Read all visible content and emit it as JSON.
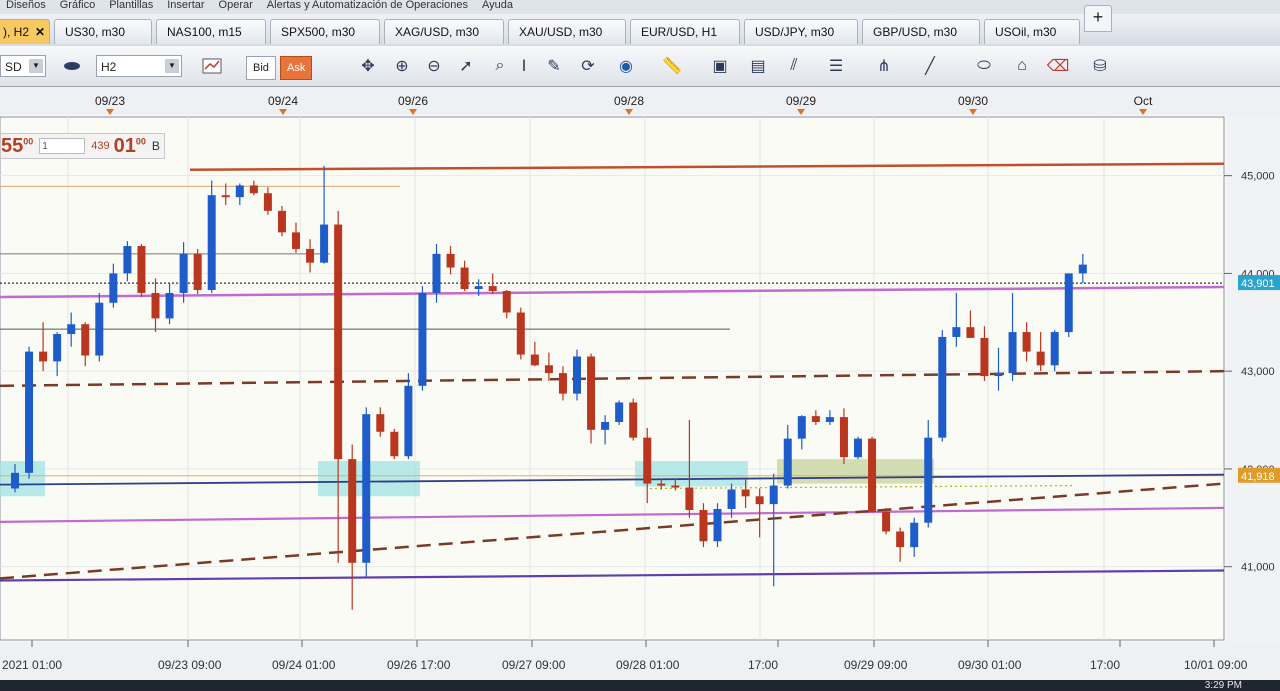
{
  "menu": [
    "Diseños",
    "Gráfico",
    "Plantillas",
    "Insertar",
    "Operar",
    "Alertas y Automatización de Operaciones",
    "Ayuda"
  ],
  "tabs": [
    {
      "label": "), H2",
      "active": true,
      "closable": true
    },
    {
      "label": "US30, m30"
    },
    {
      "label": "NAS100, m15"
    },
    {
      "label": "SPX500, m30"
    },
    {
      "label": "XAG/USD, m30"
    },
    {
      "label": "XAU/USD, m30"
    },
    {
      "label": "EUR/USD, H1"
    },
    {
      "label": "USD/JPY, m30"
    },
    {
      "label": "GBP/USD, m30"
    },
    {
      "label": "USOil, m30"
    }
  ],
  "new_tab_label": "+",
  "toolbar": {
    "symbol": "SD",
    "timeframe": "H2",
    "bid_label": "Bid",
    "ask_label": "Ask",
    "icons": [
      "chart-type-icon",
      "crosshair-icon",
      "zoom-in-icon",
      "zoom-out-icon",
      "cursor-icon",
      "magnifier-icon",
      "text-icon",
      "annotation-icon",
      "sync-icon",
      "globe-icon",
      "ruler-icon",
      "snapshot-icon",
      "template-icon",
      "fibonacci-icon",
      "lines-icon",
      "pitchfork-icon",
      "pen-icon",
      "shape-icon",
      "label-icon",
      "eraser-icon",
      "layers-icon"
    ]
  },
  "quote": {
    "price_main": "55",
    "price_sup": "00",
    "lots": "1",
    "spread": "439",
    "price2_main": "01",
    "price2_sup": "00",
    "side": "B"
  },
  "colors": {
    "bull": "#1e5cc9",
    "bear": "#b9361f",
    "red_line": "#c0502c",
    "magenta_line": "#c36ad0",
    "navy_line": "#2d3f8c",
    "purple_line": "#5f3fb0",
    "dashed_trend": "#7a3a28",
    "cyan_zone": "#9fe3e3",
    "olive_zone": "#c9d6a0",
    "price_label": "#29a3cf",
    "price_label2": "#e09b2b"
  },
  "chart_data": {
    "type": "candlestick",
    "top_date_labels": [
      "09/23",
      "09/24",
      "09/26",
      "09/28",
      "09/29",
      "09/30",
      "Oct"
    ],
    "bottom_time_labels": [
      "2021 01:00",
      "09/23 09:00",
      "09/24 01:00",
      "09/26 17:00",
      "09/27 09:00",
      "09/28 01:00",
      "17:00",
      "09/29 09:00",
      "09/30 01:00",
      "17:00",
      "10/01 09:00"
    ],
    "y_tick_labels": [
      "45,000",
      "44,000",
      "43,000",
      "42,000",
      "41,000"
    ],
    "price_labels": [
      {
        "text": "43,901",
        "kind": "current"
      },
      {
        "text": "41,918",
        "kind": "level"
      }
    ],
    "y_ticks": [
      45000,
      44000,
      43000,
      42000,
      41000
    ],
    "ylim": [
      40250,
      45600
    ],
    "levels": [
      {
        "name": "resistance-red",
        "value": 45060
      },
      {
        "name": "magenta-upper",
        "value": 43820
      },
      {
        "name": "magenta-lower",
        "value": 41540
      },
      {
        "name": "navy-support",
        "value": 41880
      },
      {
        "name": "purple-support",
        "value": 40920
      },
      {
        "name": "current-price",
        "value": 43901
      },
      {
        "name": "gold-level",
        "value": 41930
      }
    ],
    "candles": [
      [
        41800,
        42050,
        41760,
        41960
      ],
      [
        41960,
        43250,
        41900,
        43200
      ],
      [
        43200,
        43500,
        43000,
        43100
      ],
      [
        43100,
        43400,
        42950,
        43380
      ],
      [
        43380,
        43600,
        43250,
        43480
      ],
      [
        43480,
        43500,
        43050,
        43160
      ],
      [
        43160,
        43800,
        43100,
        43700
      ],
      [
        43700,
        44100,
        43650,
        44000
      ],
      [
        44000,
        44330,
        43920,
        44280
      ],
      [
        44280,
        44300,
        43760,
        43800
      ],
      [
        43800,
        43950,
        43400,
        43540
      ],
      [
        43540,
        43900,
        43480,
        43800
      ],
      [
        43800,
        44320,
        43700,
        44200
      ],
      [
        44200,
        44250,
        43790,
        43830
      ],
      [
        43830,
        44950,
        43800,
        44800
      ],
      [
        44800,
        44920,
        44700,
        44780
      ],
      [
        44780,
        44920,
        44700,
        44900
      ],
      [
        44900,
        44950,
        44800,
        44820
      ],
      [
        44820,
        44880,
        44600,
        44640
      ],
      [
        44640,
        44690,
        44380,
        44420
      ],
      [
        44420,
        44520,
        44210,
        44250
      ],
      [
        44250,
        44350,
        44010,
        44110
      ],
      [
        44110,
        45100,
        44100,
        44500
      ],
      [
        44500,
        44640,
        41040,
        42100
      ],
      [
        42100,
        42250,
        40560,
        41040
      ],
      [
        41040,
        42630,
        40900,
        42560
      ],
      [
        42560,
        42630,
        42330,
        42380
      ],
      [
        42380,
        42410,
        42100,
        42130
      ],
      [
        42130,
        42980,
        42100,
        42850
      ],
      [
        42850,
        43870,
        42800,
        43800
      ],
      [
        43800,
        44300,
        43700,
        44200
      ],
      [
        44200,
        44280,
        43990,
        44060
      ],
      [
        44060,
        44130,
        43820,
        43840
      ],
      [
        43840,
        43940,
        43770,
        43870
      ],
      [
        43870,
        44000,
        43790,
        43820
      ],
      [
        43820,
        43830,
        43540,
        43600
      ],
      [
        43600,
        43650,
        43120,
        43170
      ],
      [
        43170,
        43300,
        43050,
        43060
      ],
      [
        43060,
        43190,
        42900,
        42980
      ],
      [
        42980,
        43050,
        42700,
        42770
      ],
      [
        42770,
        43220,
        42700,
        43150
      ],
      [
        43150,
        43180,
        42260,
        42400
      ],
      [
        42400,
        42550,
        42250,
        42480
      ],
      [
        42480,
        42700,
        42450,
        42680
      ],
      [
        42680,
        42720,
        42290,
        42320
      ],
      [
        42320,
        42420,
        41650,
        41850
      ],
      [
        41850,
        41900,
        41790,
        41830
      ],
      [
        41830,
        41900,
        41780,
        41810
      ],
      [
        41810,
        42500,
        41500,
        41580
      ],
      [
        41580,
        41650,
        41200,
        41260
      ],
      [
        41260,
        41650,
        41200,
        41590
      ],
      [
        41590,
        41850,
        41500,
        41790
      ],
      [
        41790,
        41900,
        41600,
        41720
      ],
      [
        41720,
        41800,
        41300,
        41640
      ],
      [
        41640,
        41950,
        40800,
        41830
      ],
      [
        41830,
        42450,
        41800,
        42310
      ],
      [
        42310,
        42550,
        42200,
        42540
      ],
      [
        42540,
        42600,
        42450,
        42480
      ],
      [
        42480,
        42600,
        42450,
        42530
      ],
      [
        42530,
        42620,
        42050,
        42120
      ],
      [
        42120,
        42330,
        42100,
        42310
      ],
      [
        42310,
        42330,
        41550,
        41560
      ],
      [
        41560,
        41600,
        41330,
        41360
      ],
      [
        41360,
        41400,
        41050,
        41200
      ],
      [
        41200,
        41500,
        41100,
        41450
      ],
      [
        41450,
        42500,
        41400,
        42320
      ],
      [
        42320,
        43420,
        42280,
        43350
      ],
      [
        43350,
        43800,
        43250,
        43450
      ],
      [
        43450,
        43620,
        43350,
        43340
      ],
      [
        43340,
        43460,
        42900,
        42950
      ],
      [
        42950,
        43240,
        42800,
        42980
      ],
      [
        42980,
        43800,
        42900,
        43400
      ],
      [
        43400,
        43500,
        43100,
        43200
      ],
      [
        43200,
        43400,
        43000,
        43060
      ],
      [
        43060,
        43420,
        43000,
        43400
      ],
      [
        43400,
        44000,
        43350,
        44000
      ],
      [
        44000,
        44200,
        43900,
        44090
      ]
    ]
  },
  "taskbar": {
    "clock": "3:29 PM"
  }
}
